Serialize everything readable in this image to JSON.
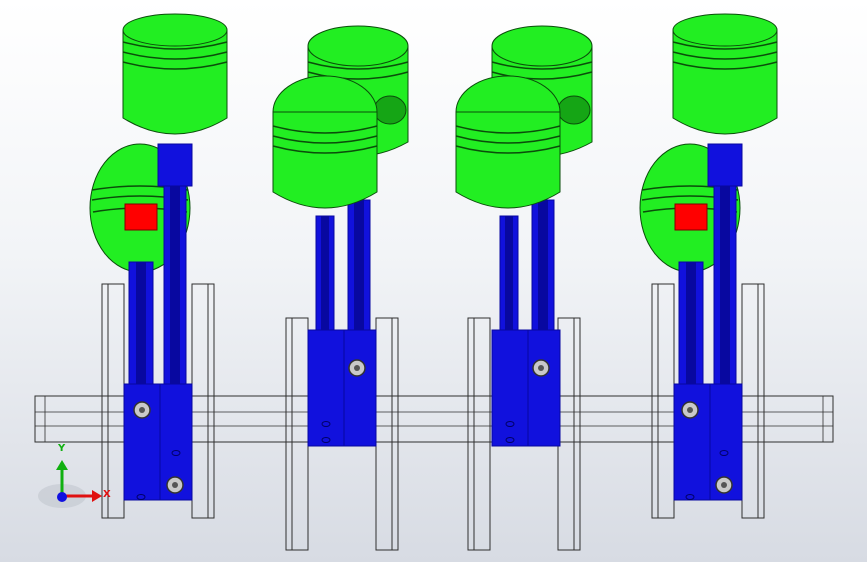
{
  "viewport": {
    "background_top": "#ffffff",
    "background_bottom": "#d7dbe3"
  },
  "colors": {
    "piston": "#22ee22",
    "piston_dark": "#15a515",
    "piston_ring": "#0b4d0b",
    "rod": "#1111dd",
    "rod_dark": "#0808a0",
    "highlight": "#ff0000",
    "wireframe": "#2f2f2f"
  },
  "triad": {
    "x_label": "X",
    "y_label": "Y",
    "x_color": "#e01010",
    "y_color": "#10b010",
    "z_color": "#1010e0"
  },
  "cylinders": [
    {
      "id": "cylinder-1",
      "piston_position": "top",
      "selected_face": true
    },
    {
      "id": "cylinder-2",
      "piston_position": "mid",
      "selected_face": false
    },
    {
      "id": "cylinder-3",
      "piston_position": "mid",
      "selected_face": false
    },
    {
      "id": "cylinder-4",
      "piston_position": "top",
      "selected_face": true
    }
  ]
}
